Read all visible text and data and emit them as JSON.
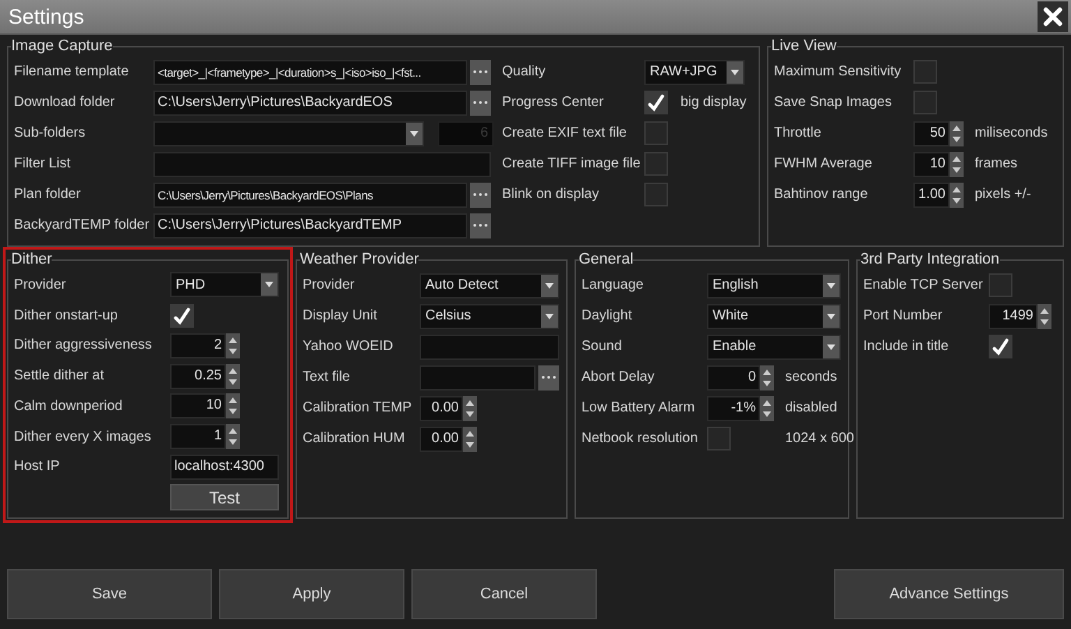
{
  "window": {
    "title": "Settings"
  },
  "groups": [
    {
      "title": "Image Capture",
      "highlighted": false,
      "columns": [
        {
          "rows": [
            {
              "kind": "text",
              "label": "Filename template",
              "value": "<target>_|<frametype>_|<duration>s_|<iso>iso_|<fst...",
              "browse": true
            },
            {
              "kind": "text",
              "label": "Download folder",
              "value": "C:\\Users\\Jerry\\Pictures\\BackyardEOS",
              "browse": true
            },
            {
              "kind": "dropdown",
              "label": "Sub-folders",
              "counter": "6",
              "counter_disabled": true
            },
            {
              "kind": "text",
              "label": "Filter List",
              "browse": false
            },
            {
              "kind": "text",
              "label": "Plan folder",
              "value": "C:\\Users\\Jerry\\Pictures\\BackyardEOS\\Plans",
              "browse": true
            },
            {
              "kind": "text",
              "label": "BackyardTEMP folder",
              "value": "C:\\Users\\Jerry\\Pictures\\BackyardTEMP",
              "browse": true
            }
          ]
        },
        {
          "rows": [
            {
              "kind": "dropdown",
              "label": "Quality",
              "value": "RAW+JPG"
            },
            {
              "kind": "checkbox",
              "label": "Progress Center",
              "checked": true,
              "suffix": "big display"
            },
            {
              "kind": "checkbox",
              "label": "Create EXIF text file",
              "checked": false
            },
            {
              "kind": "checkbox",
              "label": "Create TIFF image file",
              "checked": false
            },
            {
              "kind": "checkbox",
              "label": "Blink on display",
              "checked": false
            }
          ]
        }
      ]
    },
    {
      "title": "Live View",
      "highlighted": false,
      "columns": [
        {
          "rows": [
            {
              "kind": "checkbox",
              "label": "Maximum Sensitivity",
              "checked": false
            },
            {
              "kind": "checkbox",
              "label": "Save Snap Images",
              "checked": false
            },
            {
              "kind": "spin",
              "label": "Throttle",
              "value": "50",
              "suffix": "miliseconds"
            },
            {
              "kind": "spin",
              "label": "FWHM Average",
              "value": "10",
              "suffix": "frames"
            },
            {
              "kind": "spin",
              "label": "Bahtinov range",
              "value": "1.00",
              "suffix": "pixels +/-"
            }
          ]
        }
      ]
    },
    {
      "title": "Dither",
      "highlighted": true,
      "columns": [
        {
          "rows": [
            {
              "kind": "dropdown",
              "label": "Provider",
              "value": "PHD"
            },
            {
              "kind": "checkbox",
              "label": "Dither onstart-up",
              "checked": true
            },
            {
              "kind": "spin",
              "label": "Dither aggressiveness",
              "value": "2"
            },
            {
              "kind": "spin",
              "label": "Settle dither at",
              "value": "0.25"
            },
            {
              "kind": "spin",
              "label": "Calm downperiod",
              "value": "10"
            },
            {
              "kind": "spin",
              "label": "Dither every X images",
              "value": "1"
            },
            {
              "kind": "text",
              "label": "Host IP",
              "value": "localhost:4300",
              "browse": false
            },
            {
              "kind": "button",
              "text": "Test"
            }
          ]
        }
      ]
    },
    {
      "title": "Weather Provider",
      "highlighted": false,
      "columns": [
        {
          "rows": [
            {
              "kind": "dropdown",
              "label": "Provider",
              "value": "Auto Detect"
            },
            {
              "kind": "dropdown",
              "label": "Display Unit",
              "value": "Celsius"
            },
            {
              "kind": "text",
              "label": "Yahoo WOEID",
              "browse": false
            },
            {
              "kind": "text",
              "label": "Text file",
              "browse": true
            },
            {
              "kind": "spin",
              "label": "Calibration TEMP",
              "value": "0.00"
            },
            {
              "kind": "spin",
              "label": "Calibration HUM",
              "value": "0.00"
            }
          ]
        }
      ]
    },
    {
      "title": "General",
      "highlighted": false,
      "columns": [
        {
          "rows": [
            {
              "kind": "dropdown",
              "label": "Language",
              "value": "English"
            },
            {
              "kind": "dropdown",
              "label": "Daylight",
              "value": "White"
            },
            {
              "kind": "dropdown",
              "label": "Sound",
              "value": "Enable"
            },
            {
              "kind": "spin",
              "label": "Abort Delay",
              "value": "0",
              "suffix": "seconds"
            },
            {
              "kind": "spin",
              "label": "Low Battery Alarm",
              "value": "-1%",
              "suffix": "disabled"
            },
            {
              "kind": "checkbox",
              "label": "Netbook resolution",
              "checked": false,
              "suffix": "1024 x 600"
            }
          ]
        }
      ]
    },
    {
      "title": "3rd Party Integration",
      "highlighted": false,
      "columns": [
        {
          "rows": [
            {
              "kind": "checkbox",
              "label": "Enable TCP Server",
              "checked": false
            },
            {
              "kind": "spin",
              "label": "Port Number",
              "value": "1499"
            },
            {
              "kind": "checkbox",
              "label": "Include in title",
              "checked": true
            }
          ]
        }
      ]
    }
  ],
  "buttons": [
    {
      "label": "Save"
    },
    {
      "label": "Apply"
    },
    {
      "label": "Cancel"
    },
    {
      "label": "Advance Settings"
    }
  ]
}
